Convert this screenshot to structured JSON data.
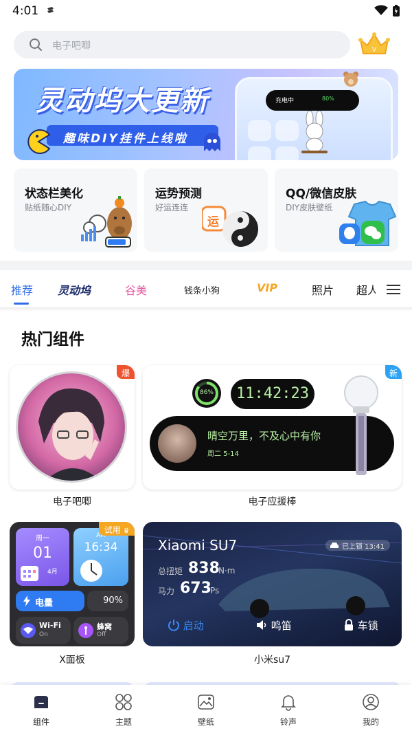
{
  "status_bar": {
    "time": "4:01"
  },
  "search": {
    "placeholder": "电子吧唧"
  },
  "banner": {
    "title": "灵动坞大更新",
    "subtitle": "趣味DIY挂件上线啦",
    "island_label": "充电中",
    "island_percent": "80%"
  },
  "features": [
    {
      "title": "状态栏美化",
      "subtitle": "贴纸随心DIY"
    },
    {
      "title": "运势预测",
      "subtitle": "好运连连",
      "art_text": "运"
    },
    {
      "title": "QQ/微信皮肤",
      "subtitle": "DIY皮肤壁纸"
    }
  ],
  "tabs": [
    {
      "label": "推荐",
      "active": true
    },
    {
      "label": "灵动坞"
    },
    {
      "label": "谷美"
    },
    {
      "label": "钱条小狗"
    },
    {
      "label": "VIP"
    },
    {
      "label": "照片"
    },
    {
      "label": "超人"
    }
  ],
  "section_title": "热门组件",
  "widgets": [
    {
      "name": "电子吧唧",
      "badge": "爆"
    },
    {
      "name": "电子应援棒",
      "badge": "新",
      "ring_text": "86%",
      "clock": "11:42:23",
      "quote": "晴空万里，不及心中有你",
      "date": "周二 5-14"
    },
    {
      "name": "X面板",
      "badge": "试用",
      "weekday": "周一",
      "day": "01",
      "month": "4月",
      "time": "16:34",
      "power_label": "电量",
      "power_percent": "90%",
      "wifi_label": "Wi-Fi",
      "wifi_state": "On",
      "cell_label": "蜂窝",
      "cell_state": "Off"
    },
    {
      "name": "小米su7",
      "model": "Xiaomi SU7",
      "lock_status": "已上锁 13:41",
      "torque_label": "总扭矩",
      "torque_value": "838",
      "torque_unit": "N·m",
      "power_label": "马力",
      "power_value": "673",
      "power_unit": "Ps",
      "start_label": "启动",
      "horn_label": "鸣笛",
      "lock_label": "车锁"
    }
  ],
  "bottom_nav": [
    {
      "label": "组件",
      "icon": "widget-icon",
      "active": true
    },
    {
      "label": "主题",
      "icon": "theme-icon"
    },
    {
      "label": "壁纸",
      "icon": "wallpaper-icon"
    },
    {
      "label": "铃声",
      "icon": "bell-icon"
    },
    {
      "label": "我的",
      "icon": "profile-icon"
    }
  ],
  "colors": {
    "accent": "#2f6de8",
    "hot_badge": "#f0522d",
    "new_badge": "#2ea2f2",
    "trial_badge": "#f5a623"
  }
}
